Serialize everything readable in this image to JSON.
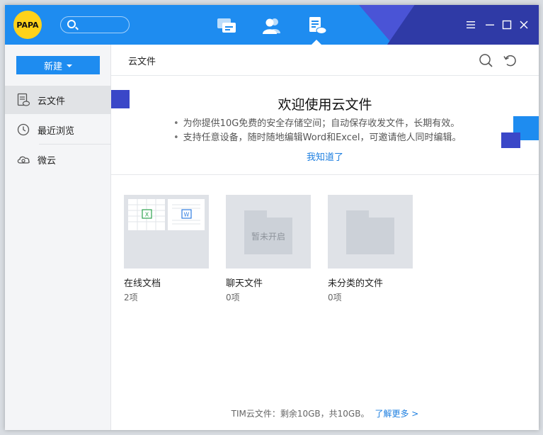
{
  "titlebar": {
    "avatar_text": "PAPA",
    "nav": [
      "chat-icon",
      "contacts-icon",
      "cloud-files-icon"
    ],
    "window_buttons": [
      "menu-icon",
      "minimize-icon",
      "maximize-icon",
      "close-icon"
    ]
  },
  "sidebar": {
    "new_label": "新建",
    "items": [
      {
        "label": "云文件",
        "icon": "cloud-file-icon",
        "active": true
      },
      {
        "label": "最近浏览",
        "icon": "clock-icon",
        "active": false
      },
      {
        "label": "微云",
        "icon": "weiyun-icon",
        "active": false
      }
    ]
  },
  "main": {
    "title": "云文件",
    "banner": {
      "title": "欢迎使用云文件",
      "lines": [
        "为你提供10G免费的安全存储空间；自动保存收发文件，长期有效。",
        "支持任意设备，随时随地编辑Word和Excel，可邀请他人同时编辑。"
      ],
      "link": "我知道了"
    },
    "tiles": [
      {
        "name": "在线文档",
        "count": "2项",
        "overlay": ""
      },
      {
        "name": "聊天文件",
        "count": "0项",
        "overlay": "暂未开启"
      },
      {
        "name": "未分类的文件",
        "count": "0项",
        "overlay": ""
      }
    ],
    "footer": {
      "text": "TIM云文件：剩余10GB，共10GB。",
      "link": "了解更多 >"
    }
  },
  "colors": {
    "accent": "#1e8cf0",
    "deco_indigo": "#3a47c8",
    "deco_navy": "#2f3aa6",
    "avatar": "#ffd21a"
  }
}
